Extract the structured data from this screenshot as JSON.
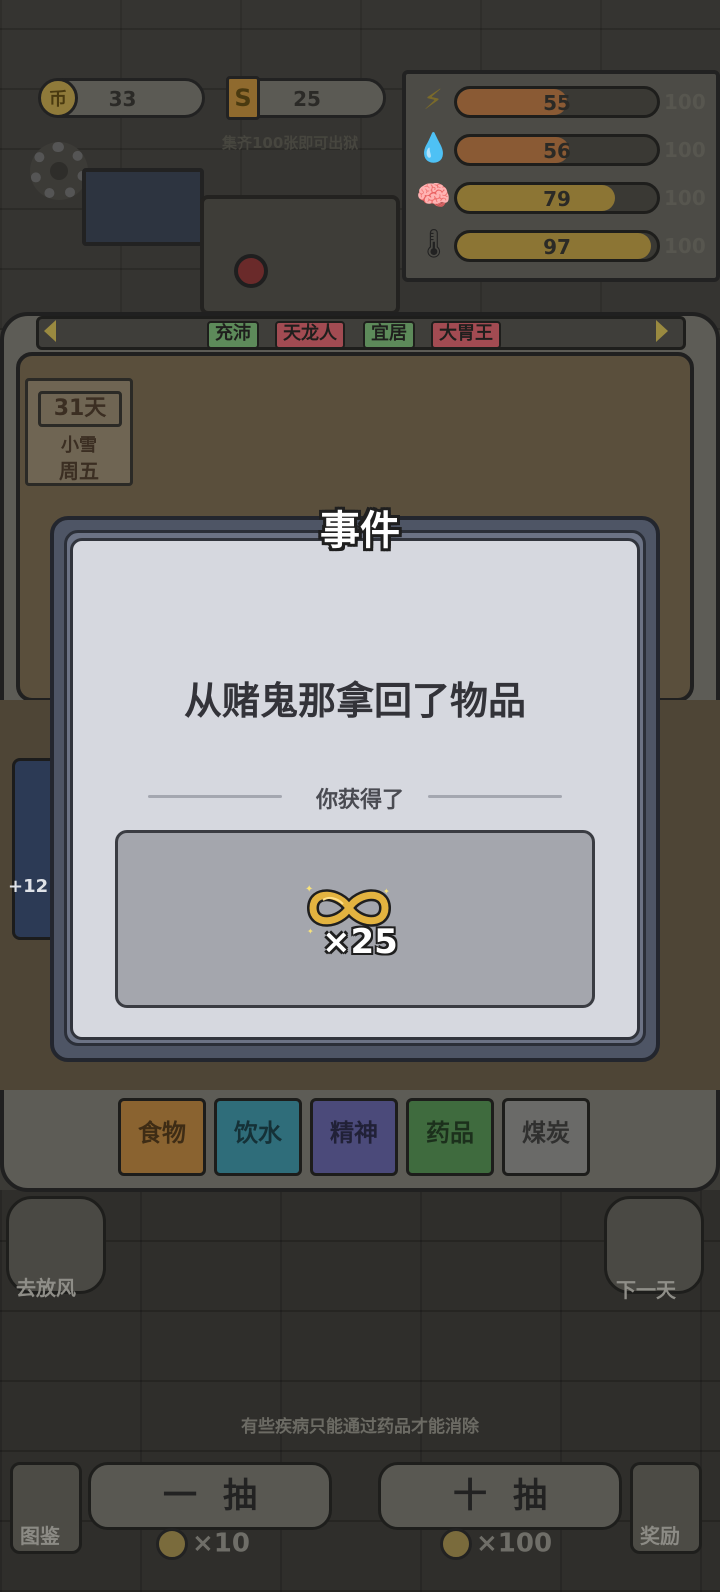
{
  "resources": {
    "coins": "33",
    "coin_icon_text": "币",
    "tickets": "25",
    "ticket_icon_text": "S",
    "collect_hint": "集齐100张即可出狱"
  },
  "stats": [
    {
      "icon": "energy-icon",
      "glyph": "⚡",
      "value": "55",
      "max": "100",
      "fill": 0.55,
      "color": "#8a5a34"
    },
    {
      "icon": "water-icon",
      "glyph": "💧",
      "value": "56",
      "max": "100",
      "fill": 0.56,
      "color": "#8a5a34"
    },
    {
      "icon": "brain-icon",
      "glyph": "🧠",
      "value": "79",
      "max": "100",
      "fill": 0.79,
      "color": "#8c7534"
    },
    {
      "icon": "thermometer-icon",
      "glyph": "🌡",
      "value": "97",
      "max": "100",
      "fill": 0.97,
      "color": "#8c7534"
    }
  ],
  "tags": [
    "充沛",
    "天龙人",
    "宜居",
    "大胃王"
  ],
  "tag_colors": [
    "#5d8a5a",
    "#a24b52",
    "#5d8a5a",
    "#a24b52"
  ],
  "day": {
    "count": "31天",
    "weather": "小雪",
    "weekday": "周五"
  },
  "left_card_label": "+12",
  "categories": [
    {
      "label": "食物",
      "color": "#8a6330"
    },
    {
      "label": "饮水",
      "color": "#2f6d7a"
    },
    {
      "label": "精神",
      "color": "#4b4a7a"
    },
    {
      "label": "药品",
      "color": "#3f6b3e"
    },
    {
      "label": "煤炭",
      "color": "#6a6a68"
    }
  ],
  "side_buttons": {
    "left": "去放风",
    "right": "下一天"
  },
  "tip": "有些疾病只能通过药品才能消除",
  "draw": {
    "single": "一抽",
    "ten": "十抽",
    "single_cost": "×10",
    "ten_cost": "×100",
    "coin_glyph": "币"
  },
  "corner": {
    "left": "图鉴",
    "right": "奖励"
  },
  "modal": {
    "title": "事件",
    "event_text": "从赌鬼那拿回了物品",
    "obtained_label": "你获得了",
    "reward_icon": "infinity-token-icon",
    "reward_count": "×25"
  }
}
